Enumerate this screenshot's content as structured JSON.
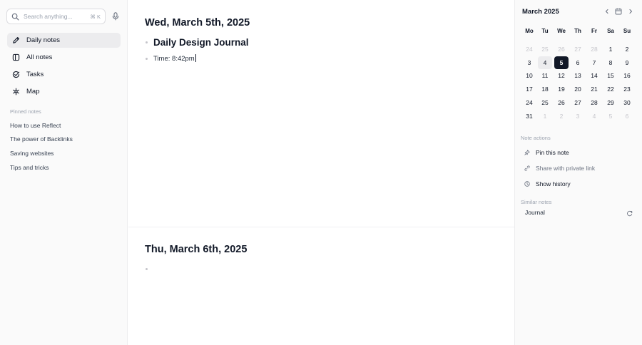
{
  "sidebar": {
    "search": {
      "placeholder": "Search anything...",
      "shortcut": "⌘ K"
    },
    "nav": [
      {
        "label": "Daily notes",
        "icon": "pencil-icon",
        "active": true
      },
      {
        "label": "All notes",
        "icon": "notes-icon",
        "active": false
      },
      {
        "label": "Tasks",
        "icon": "task-check-icon",
        "active": false
      },
      {
        "label": "Map",
        "icon": "map-graph-icon",
        "active": false
      }
    ],
    "pinned_heading": "Pinned notes",
    "pinned": [
      "How to use Reflect",
      "The power of Backlinks",
      "Saving websites",
      "Tips and tricks"
    ]
  },
  "main": {
    "days": [
      {
        "title": "Wed, March 5th, 2025",
        "heading": "Daily Design Journal",
        "time_line": "Time: 8:42pm"
      },
      {
        "title": "Thu, March 6th, 2025"
      }
    ]
  },
  "calendar": {
    "month": "March 2025",
    "weekdays": [
      "Mo",
      "Tu",
      "We",
      "Th",
      "Fr",
      "Sa",
      "Su"
    ],
    "weeks": [
      [
        {
          "d": "24",
          "m": true
        },
        {
          "d": "25",
          "m": true
        },
        {
          "d": "26",
          "m": true
        },
        {
          "d": "27",
          "m": true
        },
        {
          "d": "28",
          "m": true
        },
        {
          "d": "1"
        },
        {
          "d": "2"
        }
      ],
      [
        {
          "d": "3"
        },
        {
          "d": "4",
          "today": true
        },
        {
          "d": "5",
          "sel": true
        },
        {
          "d": "6"
        },
        {
          "d": "7"
        },
        {
          "d": "8"
        },
        {
          "d": "9"
        }
      ],
      [
        {
          "d": "10"
        },
        {
          "d": "11"
        },
        {
          "d": "12"
        },
        {
          "d": "13"
        },
        {
          "d": "14"
        },
        {
          "d": "15"
        },
        {
          "d": "16"
        }
      ],
      [
        {
          "d": "17"
        },
        {
          "d": "18"
        },
        {
          "d": "19"
        },
        {
          "d": "20"
        },
        {
          "d": "21"
        },
        {
          "d": "22"
        },
        {
          "d": "23"
        }
      ],
      [
        {
          "d": "24"
        },
        {
          "d": "25"
        },
        {
          "d": "26"
        },
        {
          "d": "27"
        },
        {
          "d": "28"
        },
        {
          "d": "29"
        },
        {
          "d": "30"
        }
      ],
      [
        {
          "d": "31"
        },
        {
          "d": "1",
          "m": true
        },
        {
          "d": "2",
          "m": true
        },
        {
          "d": "3",
          "m": true
        },
        {
          "d": "4",
          "m": true
        },
        {
          "d": "5",
          "m": true
        },
        {
          "d": "6",
          "m": true
        }
      ]
    ],
    "selected_day": "5",
    "today_day": "4"
  },
  "note_actions": {
    "heading": "Note actions",
    "items": [
      {
        "label": "Pin this note",
        "icon": "pin-icon",
        "color": "#111827"
      },
      {
        "label": "Share with private link",
        "icon": "link-icon",
        "color": "#6b7280"
      },
      {
        "label": "Show history",
        "icon": "clock-icon",
        "color": "#111827"
      }
    ]
  },
  "similar_notes": {
    "heading": "Similar notes",
    "items": [
      {
        "label": "Journal",
        "icon": "open-arrow-icon"
      }
    ]
  },
  "colors": {
    "selected_day_bg": "#111827",
    "today_bg": "#ececee",
    "panel_bg": "#fafafa",
    "muted_text": "#9ca3af"
  }
}
